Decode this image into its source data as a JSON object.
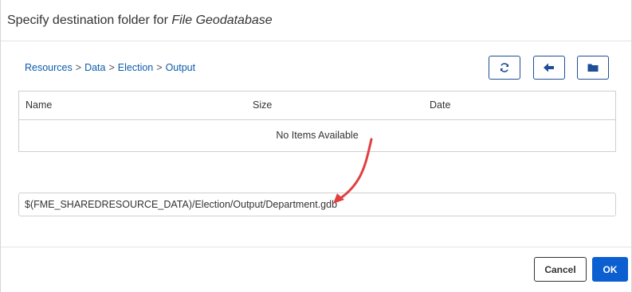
{
  "dialog": {
    "title_prefix": "Specify destination folder for ",
    "title_format": "File Geodatabase"
  },
  "breadcrumb": [
    "Resources",
    "Data",
    "Election",
    "Output"
  ],
  "breadcrumb_separator": ">",
  "toolbar": {
    "refresh_icon": "refresh-icon",
    "back_icon": "arrow-left-icon",
    "folder_icon": "folder-icon"
  },
  "table": {
    "columns": [
      "Name",
      "Size",
      "Date"
    ],
    "empty_message": "No Items Available"
  },
  "path_input": {
    "value": "$(FME_SHAREDRESOURCE_DATA)/Election/Output/Department.gdb"
  },
  "buttons": {
    "cancel": "Cancel",
    "ok": "OK"
  },
  "colors": {
    "accent": "#0b5fd1",
    "link": "#0b5cad",
    "annotation_arrow": "#e04040"
  }
}
